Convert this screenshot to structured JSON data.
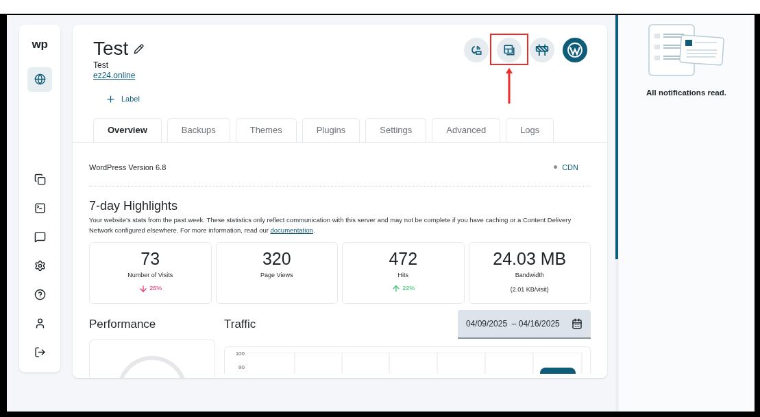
{
  "sidebar": {
    "logo": "wp",
    "items": [
      {
        "kind": "globe",
        "selected": true
      },
      {
        "kind": "copy",
        "selected": false
      },
      {
        "kind": "terminal",
        "selected": false
      },
      {
        "kind": "message",
        "selected": false
      },
      {
        "kind": "settings",
        "selected": false
      },
      {
        "kind": "help",
        "selected": false
      },
      {
        "kind": "user",
        "selected": false
      },
      {
        "kind": "logout",
        "selected": false
      }
    ]
  },
  "site": {
    "title": "Test",
    "subtitle": "Test",
    "url": "ez24.online",
    "add_label": "Label"
  },
  "toolbar": [
    {
      "kind": "restore",
      "highlighted": false
    },
    {
      "kind": "layout",
      "highlighted": true
    },
    {
      "kind": "barrier",
      "highlighted": false
    },
    {
      "kind": "wordpress",
      "highlighted": false
    }
  ],
  "tabs": [
    {
      "label": "Overview",
      "selected": true
    },
    {
      "label": "Backups",
      "selected": false
    },
    {
      "label": "Themes",
      "selected": false
    },
    {
      "label": "Plugins",
      "selected": false
    },
    {
      "label": "Settings",
      "selected": false
    },
    {
      "label": "Advanced",
      "selected": false
    },
    {
      "label": "Logs",
      "selected": false
    }
  ],
  "version": "WordPress Version 6.8",
  "cdn": {
    "label": "CDN",
    "active": false
  },
  "highlights": {
    "title": "7-day Highlights",
    "description": "Your website’s stats from the past week. These statistics only reflect communication with this server and may not be complete if you have caching or a Content Delivery Network configured elsewhere. For more information, read our",
    "link": "documentation",
    "after": "."
  },
  "stats": [
    {
      "value": "73",
      "label": "Number of Visits",
      "change": {
        "kind": "down",
        "text": "26%"
      }
    },
    {
      "value": "320",
      "label": "Page Views"
    },
    {
      "value": "472",
      "label": "Hits",
      "change": {
        "kind": "up",
        "text": "22%"
      }
    },
    {
      "value": "24.03 MB",
      "label": "Bandwidth",
      "note": "(2.01 KB/visit)"
    }
  ],
  "performance": {
    "title": "Performance"
  },
  "traffic": {
    "title": "Traffic",
    "date_range": "04/09/2025  – 04/16/2025",
    "y_ticks": [
      "100",
      "90"
    ]
  },
  "notifications": {
    "message": "All notifications read."
  }
}
